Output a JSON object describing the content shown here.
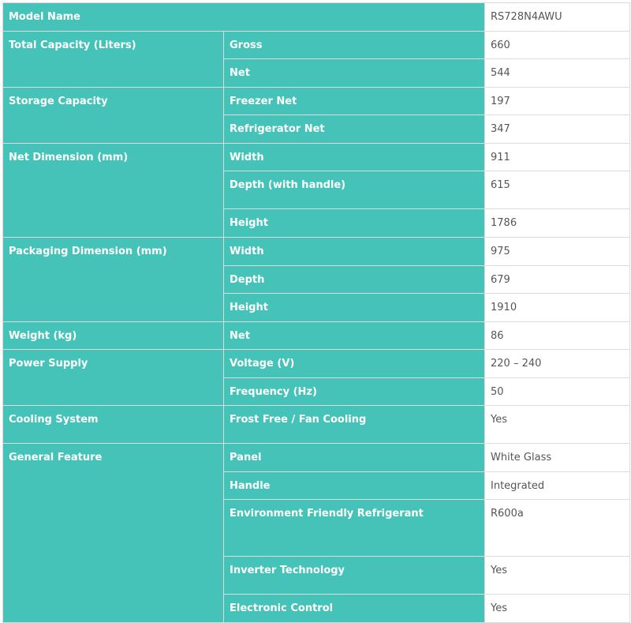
{
  "spec_table": {
    "model_name": {
      "label": "Model Name",
      "value": "RS728N4AWU"
    },
    "groups": [
      {
        "label": "Total Capacity (Liters)",
        "rows": [
          {
            "attribute": "Gross",
            "value": "660"
          },
          {
            "attribute": "Net",
            "value": "544"
          }
        ]
      },
      {
        "label": "Storage Capacity",
        "rows": [
          {
            "attribute": "Freezer Net",
            "value": "197"
          },
          {
            "attribute": "Refrigerator Net",
            "value": "347"
          }
        ]
      },
      {
        "label": "Net Dimension (mm)",
        "rows": [
          {
            "attribute": "Width",
            "value": "911"
          },
          {
            "attribute": "Depth (with handle)",
            "value": "615"
          },
          {
            "attribute": "Height",
            "value": "1786"
          }
        ]
      },
      {
        "label": "Packaging Dimension (mm)",
        "rows": [
          {
            "attribute": "Width",
            "value": "975"
          },
          {
            "attribute": "Depth",
            "value": "679"
          },
          {
            "attribute": "Height",
            "value": "1910"
          }
        ]
      },
      {
        "label": "Weight (kg)",
        "rows": [
          {
            "attribute": "Net",
            "value": "86"
          }
        ]
      },
      {
        "label": "Power Supply",
        "rows": [
          {
            "attribute": "Voltage (V)",
            "value": "220 – 240"
          },
          {
            "attribute": "Frequency (Hz)",
            "value": "50"
          }
        ]
      },
      {
        "label": "Cooling System",
        "rows": [
          {
            "attribute": "Frost Free / Fan Cooling",
            "value": "Yes"
          }
        ]
      },
      {
        "label": "General Feature",
        "rows": [
          {
            "attribute": "Panel",
            "value": "White Glass"
          },
          {
            "attribute": "Handle",
            "value": "Integrated"
          },
          {
            "attribute": "Environment Friendly Refrigerant",
            "value": "R600a"
          },
          {
            "attribute": "Inverter Technology",
            "value": "Yes"
          },
          {
            "attribute": "Electronic Control",
            "value": "Yes"
          }
        ]
      }
    ],
    "colors": {
      "header_bg": "#45c3b8",
      "header_text": "#ffffff",
      "value_text": "#555555",
      "border": "#dcdcdc"
    }
  }
}
